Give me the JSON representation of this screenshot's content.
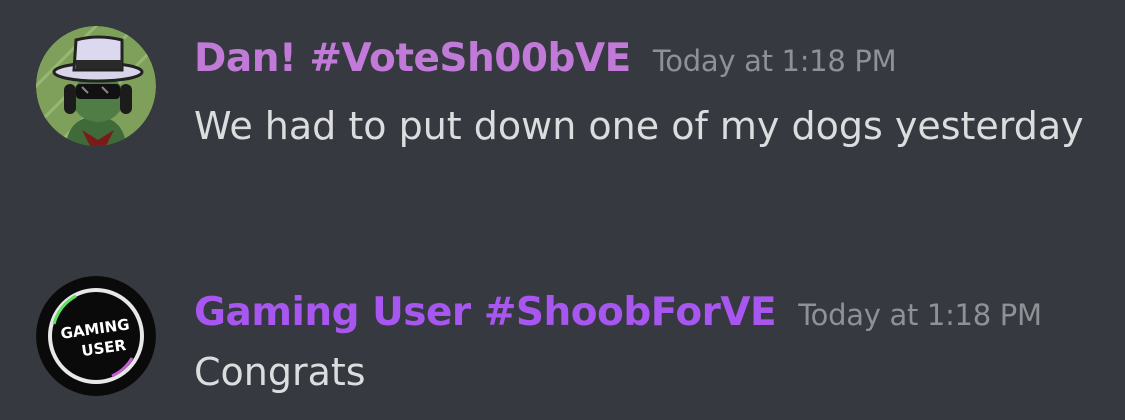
{
  "messages": [
    {
      "username": "Dan! #VoteSh00bVE",
      "timestamp": "Today at 1:18 PM",
      "text": "We had to put down one of my dogs yesterday",
      "username_color": "#c27ad8",
      "avatar_icon": "top-hat-sunglasses-character-avatar"
    },
    {
      "username": "Gaming User #ShoobForVE",
      "timestamp": "Today at 1:18 PM",
      "text": "Congrats",
      "username_color": "#a757f0",
      "avatar_icon": "gaming-user-logo-avatar",
      "avatar_text": "GAMING USER"
    }
  ],
  "colors": {
    "background": "#36393f",
    "message_text": "#dcddde",
    "timestamp": "#8e9297"
  }
}
